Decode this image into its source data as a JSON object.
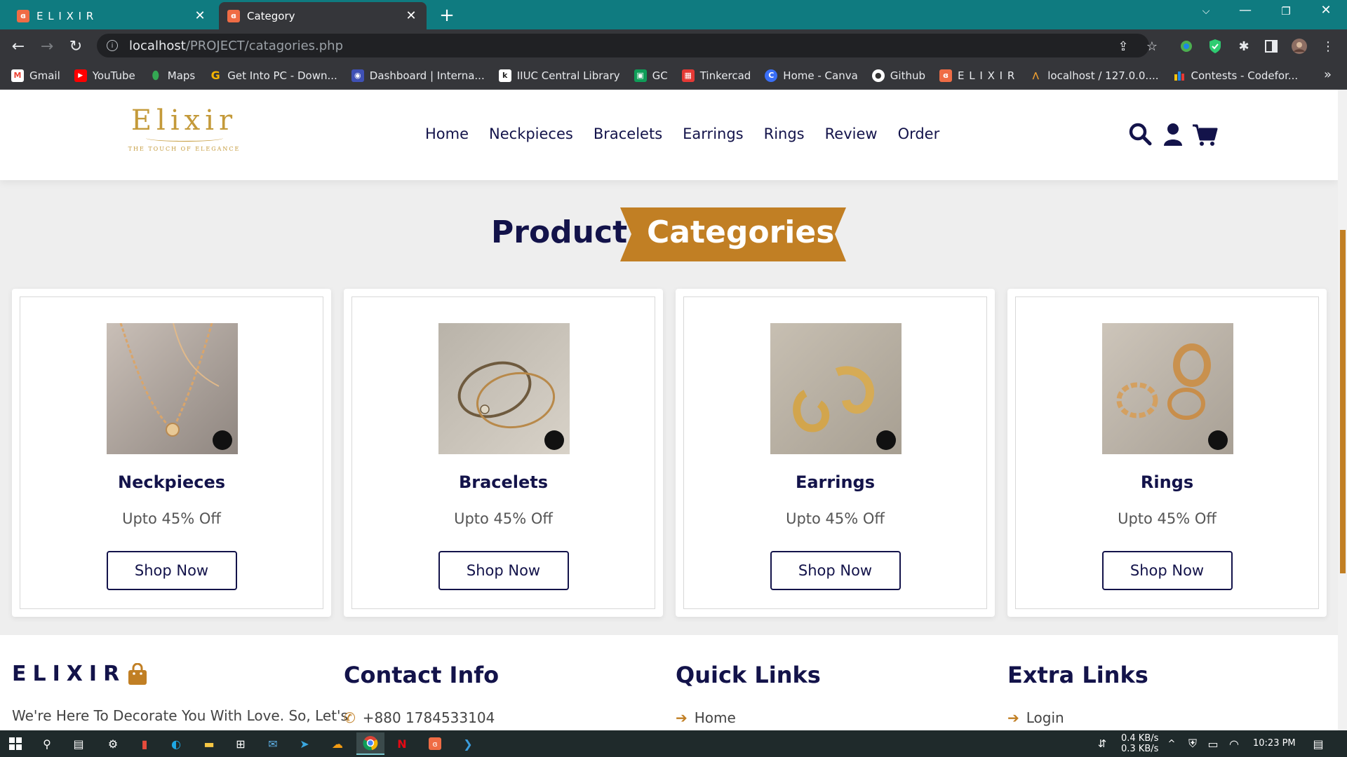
{
  "browser": {
    "tabs": [
      {
        "title": "E L I X I R",
        "active": false
      },
      {
        "title": "Category",
        "active": true
      }
    ],
    "url_host": "localhost",
    "url_path": "/PROJECT/catagories.php",
    "bookmarks": [
      {
        "label": "Gmail",
        "icon": "gmail-icon",
        "color": "#ea4335"
      },
      {
        "label": "YouTube",
        "icon": "youtube-icon",
        "color": "#ff0000"
      },
      {
        "label": "Maps",
        "icon": "maps-icon",
        "color": "#34a853"
      },
      {
        "label": "Get Into PC - Down...",
        "icon": "g-icon",
        "color": "#f4b400"
      },
      {
        "label": "Dashboard | Interna...",
        "icon": "dashboard-icon",
        "color": "#3f51b5"
      },
      {
        "label": "IIUC Central Library",
        "icon": "library-icon",
        "color": "#222222"
      },
      {
        "label": "GC",
        "icon": "classroom-icon",
        "color": "#0f9d58"
      },
      {
        "label": "Tinkercad",
        "icon": "tinkercad-icon",
        "color": "#e53935"
      },
      {
        "label": "Home - Canva",
        "icon": "canva-icon",
        "color": "#00c4cc"
      },
      {
        "label": "Github",
        "icon": "github-icon",
        "color": "#333333"
      },
      {
        "label": "E L I X I R",
        "icon": "elixir-icon",
        "color": "#ef6c45"
      },
      {
        "label": "localhost / 127.0.0....",
        "icon": "phpmyadmin-icon",
        "color": "#f0a030"
      },
      {
        "label": "Contests - Codefor...",
        "icon": "codeforces-icon",
        "color": "#1e88e5"
      }
    ]
  },
  "site": {
    "logo_word": "Elixir",
    "logo_tagline": "THE TOUCH OF ELEGANCE",
    "nav": [
      "Home",
      "Neckpieces",
      "Bracelets",
      "Earrings",
      "Rings",
      "Review",
      "Order"
    ],
    "heading_part1": "Product",
    "heading_part2": "Categories",
    "categories": [
      {
        "title": "Neckpieces",
        "discount": "Upto 45% Off",
        "button": "Shop Now"
      },
      {
        "title": "Bracelets",
        "discount": "Upto 45% Off",
        "button": "Shop Now"
      },
      {
        "title": "Earrings",
        "discount": "Upto 45% Off",
        "button": "Shop Now"
      },
      {
        "title": "Rings",
        "discount": "Upto 45% Off",
        "button": "Shop Now"
      }
    ],
    "footer": {
      "brand": "ELIXIR",
      "brand_text": "We're Here To Decorate You With Love. So, Let's",
      "contact_heading": "Contact Info",
      "phone": "+880 1784533104",
      "quick_heading": "Quick Links",
      "quick_first": "Home",
      "extra_heading": "Extra Links",
      "extra_first": "Login"
    },
    "colors": {
      "navy": "#13134a",
      "gold": "#c17f24"
    }
  },
  "taskbar": {
    "net_down": "0.4 KB/s",
    "net_up": "0.3 KB/s",
    "time": "10:23 PM"
  }
}
